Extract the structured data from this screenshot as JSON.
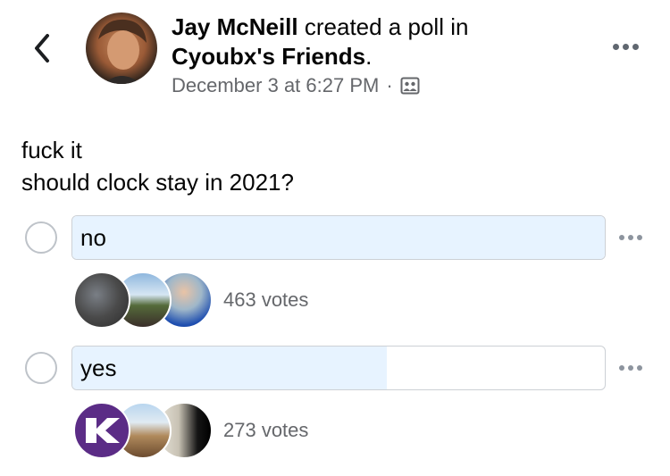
{
  "post": {
    "author": "Jay McNeill",
    "action": " created a poll in",
    "group": "Cyoubx's Friends",
    "group_suffix": ".",
    "timestamp": "December 3 at 6:27 PM",
    "separator": "·",
    "audience_icon": "group-audience-icon",
    "text_line1": "fuck it",
    "text_line2": "should clock stay in 2021?"
  },
  "poll": {
    "options": [
      {
        "label": "no",
        "votes_text": "463 votes",
        "votes": 463,
        "fill_percent": 100
      },
      {
        "label": "yes",
        "votes_text": "273 votes",
        "votes": 273,
        "fill_percent": 59
      }
    ]
  },
  "icons": {
    "back": "chevron-left-icon",
    "more": "more-horizontal-icon",
    "radio": "radio-circle-icon"
  },
  "colors": {
    "bar_fill": "#e7f3ff",
    "secondary_text": "#65676b",
    "option_border": "#ccd0d5"
  }
}
